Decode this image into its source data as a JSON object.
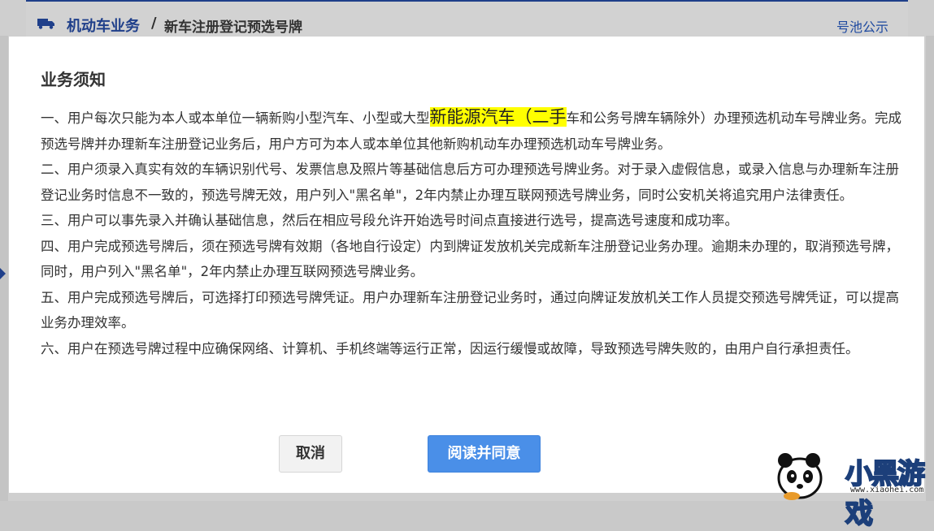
{
  "background": {
    "breadcrumb_main": "机动车业务",
    "breadcrumb_sep": "/",
    "breadcrumb_sub": "新车注册登记预选号牌",
    "header_link": "号池公示"
  },
  "modal": {
    "title": "业务须知",
    "paragraphs": {
      "p1_before": "一、用户每次只能为本人或本单位一辆新购小型汽车、小型或大型",
      "p1_highlight": "新能源汽车（二手",
      "p1_after": "车和公务号牌车辆除外）办理预选机动车号牌业务。完成预选号牌并办理新车注册登记业务后，用户方可为本人或本单位其他新购机动车办理预选机动车号牌业务。",
      "p2": "二、用户须录入真实有效的车辆识别代号、发票信息及照片等基础信息后方可办理预选号牌业务。对于录入虚假信息，或录入信息与办理新车注册登记业务时信息不一致的，预选号牌无效，用户列入\"黑名单\"，2年内禁止办理互联网预选号牌业务，同时公安机关将追究用户法律责任。",
      "p3": "三、用户可以事先录入并确认基础信息，然后在相应号段允许开始选号时间点直接进行选号，提高选号速度和成功率。",
      "p4": "四、用户完成预选号牌后，须在预选号牌有效期（各地自行设定）内到牌证发放机关完成新车注册登记业务办理。逾期未办理的，取消预选号牌，同时，用户列入\"黑名单\"，2年内禁止办理互联网预选号牌业务。",
      "p5": "五、用户完成预选号牌后，可选择打印预选号牌凭证。用户办理新车注册登记业务时，通过向牌证发放机关工作人员提交预选号牌凭证，可以提高业务办理效率。",
      "p6": "六、用户在预选号牌过程中应确保网络、计算机、手机终端等运行正常，因运行缓慢或故障，导致预选号牌失败的，由用户自行承担责任。"
    },
    "cancel_label": "取消",
    "agree_label": "阅读并同意",
    "highlight_color": "#ffff00",
    "primary_color": "#4a8fe8"
  },
  "watermark": {
    "text": "小黑游戏",
    "url": "www.xiaohei.com",
    "icon": "panda-icon"
  }
}
